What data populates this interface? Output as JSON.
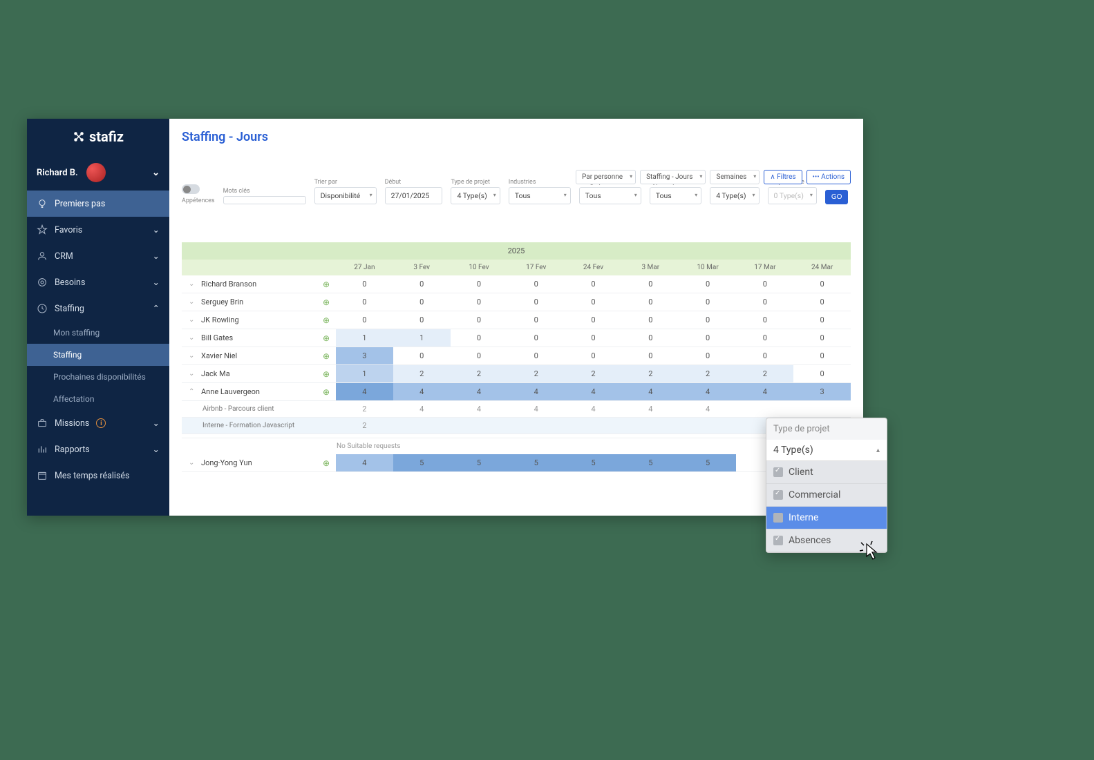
{
  "brand": "stafiz",
  "user_name": "Richard B.",
  "nav": {
    "premiers": "Premiers pas",
    "favoris": "Favoris",
    "crm": "CRM",
    "besoins": "Besoins",
    "staffing": "Staffing",
    "mon_staffing": "Mon staffing",
    "staffing_sub": "Staffing",
    "prochaines": "Prochaines disponibilités",
    "affectation": "Affectation",
    "missions": "Missions",
    "rapports": "Rapports",
    "mes_temps": "Mes temps réalisés"
  },
  "page_title": "Staffing - Jours",
  "toolbar": {
    "par_personne": "Par personne",
    "staffing_jours": "Staffing - Jours",
    "semaines": "Semaines",
    "filtres": "∧ Filtres",
    "actions": "••• Actions"
  },
  "filters": {
    "appetences_label": "Appétences",
    "mots_cles_label": "Mots clés",
    "trier_par_label": "Trier par",
    "trier_par_value": "Disponibilité",
    "debut_label": "Début",
    "debut_value": "27/01/2025",
    "type_projet_label": "Type de projet",
    "type_projet_value": "4 Type(s)",
    "industries_label": "Industries",
    "industries_value": "Tous",
    "geographie_label": "Géographie",
    "geographie_value": "Tous",
    "type_personnes_label": "Type de personnes",
    "type_personnes_value": "Tous",
    "grade_label": "Grade",
    "grade_value": "4 Type(s)",
    "par_personne_label": "Par personne",
    "par_personne_value": "0 Type(s)",
    "go": "GO"
  },
  "table": {
    "year": "2025",
    "headers": [
      "27 Jan",
      "3 Fev",
      "10 Fev",
      "17 Fev",
      "24 Fev",
      "3 Mar",
      "10 Mar",
      "17 Mar",
      "24 Mar"
    ],
    "rows": [
      {
        "name": "Richard Branson",
        "expanded": false,
        "cells": [
          "0",
          "0",
          "0",
          "0",
          "0",
          "0",
          "0",
          "0",
          "0"
        ],
        "shades": [
          0,
          0,
          0,
          0,
          0,
          0,
          0,
          0,
          0
        ]
      },
      {
        "name": "Serguey Brin",
        "expanded": false,
        "cells": [
          "0",
          "0",
          "0",
          "0",
          "0",
          "0",
          "0",
          "0",
          "0"
        ],
        "shades": [
          0,
          0,
          0,
          0,
          0,
          0,
          0,
          0,
          0
        ]
      },
      {
        "name": "JK Rowling",
        "expanded": false,
        "cells": [
          "0",
          "0",
          "0",
          "0",
          "0",
          "0",
          "0",
          "0",
          "0"
        ],
        "shades": [
          0,
          0,
          0,
          0,
          0,
          0,
          0,
          0,
          0
        ]
      },
      {
        "name": "Bill Gates",
        "expanded": false,
        "cells": [
          "1",
          "1",
          "0",
          "0",
          "0",
          "0",
          "0",
          "0",
          "0"
        ],
        "shades": [
          1,
          1,
          0,
          0,
          0,
          0,
          0,
          0,
          0
        ]
      },
      {
        "name": "Xavier Niel",
        "expanded": false,
        "cells": [
          "3",
          "0",
          "0",
          "0",
          "0",
          "0",
          "0",
          "0",
          "0"
        ],
        "shades": [
          3,
          0,
          0,
          0,
          0,
          0,
          0,
          0,
          0
        ]
      },
      {
        "name": "Jack Ma",
        "expanded": false,
        "cells": [
          "1",
          "2",
          "2",
          "2",
          "2",
          "2",
          "2",
          "2",
          "0"
        ],
        "shades": [
          2,
          1,
          1,
          1,
          1,
          1,
          1,
          1,
          0
        ]
      },
      {
        "name": "Anne Lauvergeon",
        "expanded": true,
        "cells": [
          "4",
          "4",
          "4",
          "4",
          "4",
          "4",
          "4",
          "4",
          "3"
        ],
        "shades": [
          4,
          3,
          3,
          3,
          3,
          3,
          3,
          3,
          3
        ]
      }
    ],
    "sub_rows": [
      {
        "name": "Airbnb - Parcours client",
        "cells": [
          "2",
          "4",
          "4",
          "4",
          "4",
          "4",
          "4",
          "",
          ""
        ],
        "hl": false
      },
      {
        "name": "Interne - Formation Javascript",
        "cells": [
          "2",
          "",
          "",
          "",
          "",
          "",
          "",
          "",
          ""
        ],
        "hl": true
      }
    ],
    "no_suitable": "No Suitable requests",
    "last_row": {
      "name": "Jong-Yong Yun",
      "expanded": false,
      "cells": [
        "4",
        "5",
        "5",
        "5",
        "5",
        "5",
        "5",
        "",
        ""
      ],
      "shades": [
        3,
        4,
        4,
        4,
        4,
        4,
        4,
        0,
        0
      ]
    }
  },
  "popup": {
    "title": "Type de projet",
    "selected": "4 Type(s)",
    "caret": "▴",
    "options": [
      {
        "label": "Client",
        "checked": true,
        "active": false
      },
      {
        "label": "Commercial",
        "checked": true,
        "active": false
      },
      {
        "label": "Interne",
        "checked": false,
        "active": true
      },
      {
        "label": "Absences",
        "checked": true,
        "active": false
      }
    ]
  }
}
